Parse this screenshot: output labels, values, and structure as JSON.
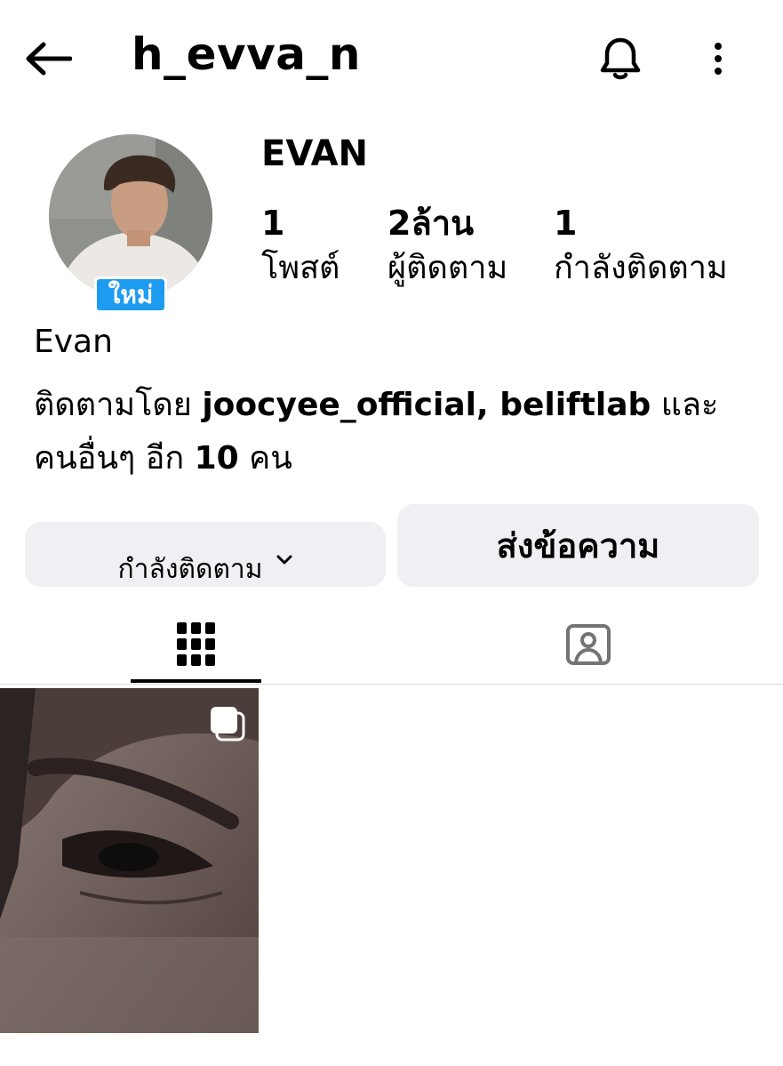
{
  "header": {
    "username": "h_evva_n",
    "back_icon": "arrow-left-icon",
    "notification_icon": "bell-icon",
    "menu_icon": "more-vertical-icon"
  },
  "profile": {
    "display_name": "EVAN",
    "new_badge": "ใหม่",
    "stats": [
      {
        "value": "1",
        "label": "โพสต์"
      },
      {
        "value": "2ล้าน",
        "label": "ผู้ติดตาม"
      },
      {
        "value": "1",
        "label": "กำลังติดตาม"
      }
    ],
    "bio_name": "Evan",
    "followed_by": {
      "prefix": "ติดตามโดย ",
      "accounts": "joocyee_official, beliftlab",
      "middle": " และ",
      "line2_prefix": "คนอื่นๆ อีก ",
      "count": "10",
      "suffix": " คน"
    }
  },
  "actions": {
    "following_label": "กำลังติดตาม",
    "message_label": "ส่งข้อความ"
  },
  "tabs": [
    {
      "name": "posts-grid",
      "icon": "grid-icon",
      "active": true
    },
    {
      "name": "tagged",
      "icon": "tagged-person-icon",
      "active": false
    }
  ],
  "colors": {
    "badge": "#1d9bf0",
    "button_bg": "#eff0f3",
    "divider": "#dbdbdb"
  }
}
